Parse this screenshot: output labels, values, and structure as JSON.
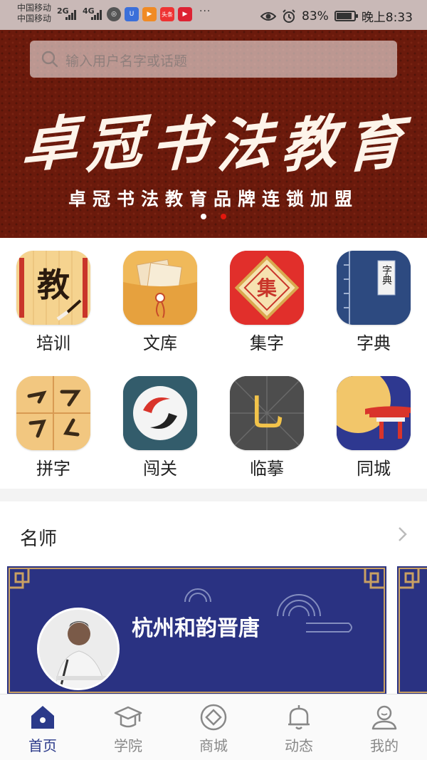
{
  "status_bar": {
    "carrier_1": "中国移动",
    "carrier_2": "中国移动",
    "net_1": "2G",
    "net_2": "4G",
    "more": "···",
    "battery_percent": "83%",
    "time": "晚上8:33",
    "app_icons": [
      "browser-icon",
      "u-app-icon",
      "video-app-icon",
      "toutiao-app-icon",
      "live-app-icon"
    ],
    "toutiao_label": "头条"
  },
  "banner": {
    "search_placeholder": "输入用户名字或话题",
    "calligraphy": [
      "卓",
      "冠",
      "书",
      "法",
      "教",
      "育"
    ],
    "subtitle": "卓冠书法教育品牌连锁加盟",
    "slides": 2,
    "active_slide": 2
  },
  "grid": {
    "items": [
      {
        "label": "培训",
        "glyph": "教"
      },
      {
        "label": "文库"
      },
      {
        "label": "集字",
        "glyph": "集"
      },
      {
        "label": "字典",
        "glyph": "字典"
      },
      {
        "label": "拼字"
      },
      {
        "label": "闯关"
      },
      {
        "label": "临摹",
        "glyph": "乚"
      },
      {
        "label": "同城"
      }
    ]
  },
  "section": {
    "title": "名师"
  },
  "teacher": {
    "name": "杭州和韵晋唐"
  },
  "tabbar": {
    "tabs": [
      {
        "label": "首页",
        "icon": "home-icon",
        "active": true
      },
      {
        "label": "学院",
        "icon": "graduation-cap-icon"
      },
      {
        "label": "商城",
        "icon": "shop-coin-icon"
      },
      {
        "label": "动态",
        "icon": "bell-icon"
      },
      {
        "label": "我的",
        "icon": "user-icon"
      }
    ]
  },
  "colors": {
    "banner_bg": "#6b1a0c",
    "accent_blue": "#2b3a8a",
    "dot_active": "#e3170d",
    "card_bg": "#2a3282",
    "card_frame": "#c9a063"
  }
}
